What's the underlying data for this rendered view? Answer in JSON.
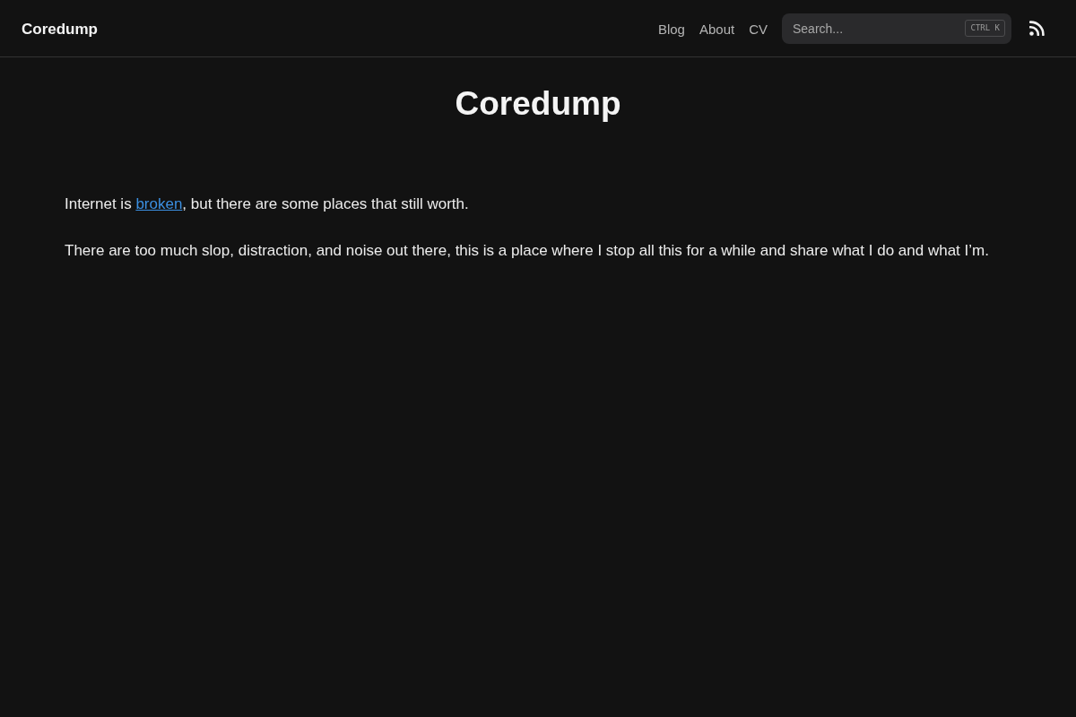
{
  "header": {
    "site_title": "Coredump",
    "nav": [
      {
        "label": "Blog"
      },
      {
        "label": "About"
      },
      {
        "label": "CV"
      }
    ],
    "search": {
      "placeholder": "Search...",
      "shortcut": "CTRL K"
    }
  },
  "page_title": "Coredump",
  "paragraphs": [
    {
      "parts": [
        {
          "kind": "text",
          "text": "Internet is "
        },
        {
          "kind": "link",
          "text": "broken"
        },
        {
          "kind": "text",
          "text": ", but there are some places that still worth."
        }
      ]
    },
    {
      "parts": [
        {
          "kind": "text",
          "text": "There are too much slop, distraction, and noise out there, this is a place where I stop all this for a while and share what I do and what I’m."
        }
      ]
    }
  ]
}
